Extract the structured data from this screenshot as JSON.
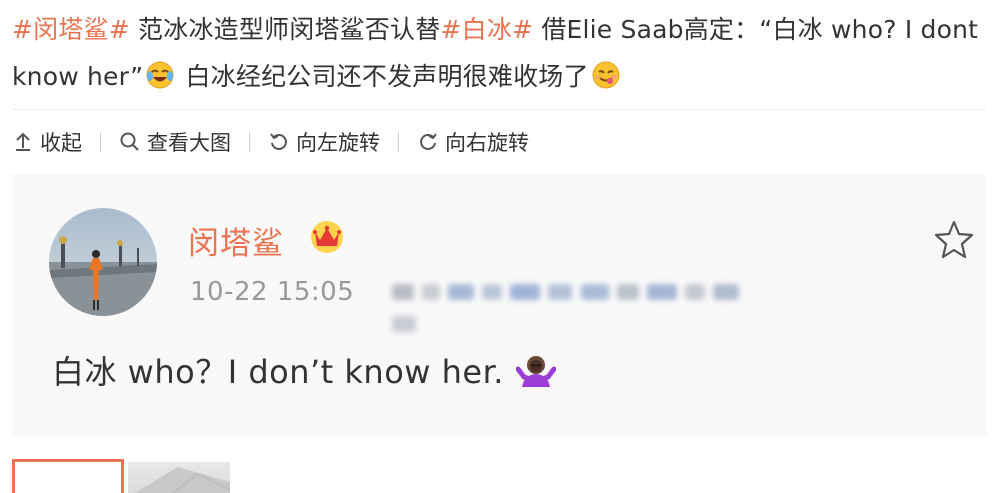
{
  "post": {
    "topic1": "#闵塔鲨#",
    "text1": " 范冰冰造型师闵塔鲨否认替",
    "topic2": "#白冰#",
    "text2": " 借Elie Saab高定：“白冰 who? I dont know her”",
    "text3": " 白冰经纪公司还不发声明很难收场了",
    "emoji1": "laugh-cry-emoji",
    "emoji2": "yum-emoji"
  },
  "toolbar": {
    "collapse": "收起",
    "view_large": "查看大图",
    "rotate_left": "向左旋转",
    "rotate_right": "向右旋转"
  },
  "repost": {
    "user_name": "闵塔鲨",
    "badge": "crown-icon",
    "time": "10-22 15:05",
    "body": "白冰 who？I don’t know her.",
    "body_emoji": "shrug-emoji"
  },
  "colors": {
    "topic": "#eb7350",
    "text": "#333333",
    "meta": "#999999",
    "card_bg": "#f9f9f9"
  }
}
